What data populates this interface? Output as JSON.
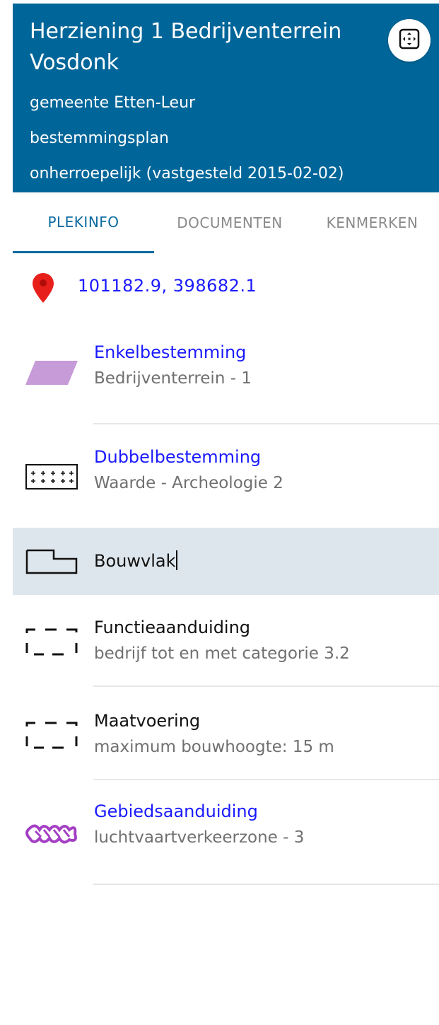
{
  "header": {
    "title": "Herziening 1 Bedrijventerrein Vosdonk",
    "municipality": "gemeente Etten-Leur",
    "plan_type": "bestemmingsplan",
    "status": "onherroepelijk (vastgesteld 2015-02-02)",
    "fullscreen_icon": "expand-arrows-icon",
    "bg_color": "#006699"
  },
  "tabs": [
    {
      "label": "PLEKINFO",
      "active": true
    },
    {
      "label": "DOCUMENTEN",
      "active": false
    },
    {
      "label": "KENMERKEN",
      "active": false
    }
  ],
  "location": {
    "icon": "map-pin-icon",
    "coordinates": "101182.9, 398682.1"
  },
  "items": [
    {
      "title": "Enkelbestemming",
      "subtitle": "Bedrijventerrein - 1",
      "icon": "parallelogram-purple-icon",
      "link": true
    },
    {
      "title": "Dubbelbestemming",
      "subtitle": "Waarde - Archeologie 2",
      "icon": "plus-grid-icon",
      "link": true
    },
    {
      "title": "Bouwvlak",
      "subtitle": "",
      "icon": "building-plane-outline-icon",
      "link": false,
      "highlighted": true
    },
    {
      "title": "Functieaanduiding",
      "subtitle": "bedrijf tot en met categorie 3.2",
      "icon": "dashed-rectangle-icon",
      "link": false
    },
    {
      "title": "Maatvoering",
      "subtitle": "maximum bouwhoogte: 15 m",
      "icon": "dashed-rectangle-icon",
      "link": false
    },
    {
      "title": "Gebiedsaanduiding",
      "subtitle": "luchtvaartverkeerzone - 3",
      "icon": "zigzag-area-purple-icon",
      "link": true
    }
  ]
}
